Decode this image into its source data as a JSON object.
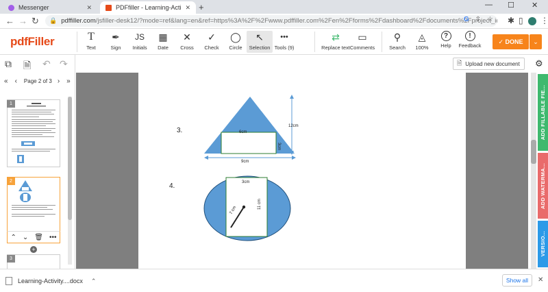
{
  "browser": {
    "tabs": [
      {
        "label": "Messenger",
        "color": "#a25ee8"
      },
      {
        "label": "PDFfiller - Learning-Activity-Shee",
        "color": "#e64a19"
      }
    ],
    "url_main": "pdffiller.com",
    "url_rest": "/jsfiller-desk12/?mode=ref&lang=en&ref=https%3A%2F%2Fwww.pdffiller.com%2Fen%2Fforms%2Fdashboard%2Fdocuments%2Fproject_id=12451..."
  },
  "toolbar": {
    "logo": "pdfFiller",
    "tools": [
      {
        "label": "Text",
        "icon": "T"
      },
      {
        "label": "Sign",
        "icon": "✒"
      },
      {
        "label": "Initials",
        "icon": "JS"
      },
      {
        "label": "Date",
        "icon": "▦"
      },
      {
        "label": "Cross",
        "icon": "✕"
      },
      {
        "label": "Check",
        "icon": "✓"
      },
      {
        "label": "Circle",
        "icon": "◯"
      },
      {
        "label": "Selection",
        "icon": "↖"
      },
      {
        "label": "Tools (9)",
        "icon": "•••"
      }
    ],
    "right_tools": [
      {
        "label": "Replace text",
        "icon": "⇄"
      },
      {
        "label": "Comments",
        "icon": "▭"
      },
      {
        "label": "Search",
        "icon": "⚲"
      },
      {
        "label": "100%",
        "icon": "◬"
      },
      {
        "label": "Help",
        "icon": "?"
      },
      {
        "label": "Feedback",
        "icon": "!"
      }
    ],
    "done_label": "✓ DONE"
  },
  "sidebar": {
    "page_indicator": "Page 2 of 3",
    "pages": [
      "1",
      "2",
      "3"
    ]
  },
  "document": {
    "upload_label": "Upload new document",
    "problem3": {
      "number": "3.",
      "top": "6cm",
      "height": "12cm",
      "side": "3cm",
      "base": "9cm"
    },
    "problem4": {
      "number": "4.",
      "top": "3cm",
      "radius": "7 cm",
      "height": "11 cm"
    }
  },
  "right_tabs": [
    {
      "label": "ADD FILLABLE FIE...",
      "color": "#3fb96e"
    },
    {
      "label": "ADD WATERMA...",
      "color": "#e96b6b"
    },
    {
      "label": "VERSIO...",
      "color": "#2c9ae8"
    }
  ],
  "downloads": {
    "file": "Learning-Activity....docx",
    "show_all": "Show all"
  }
}
